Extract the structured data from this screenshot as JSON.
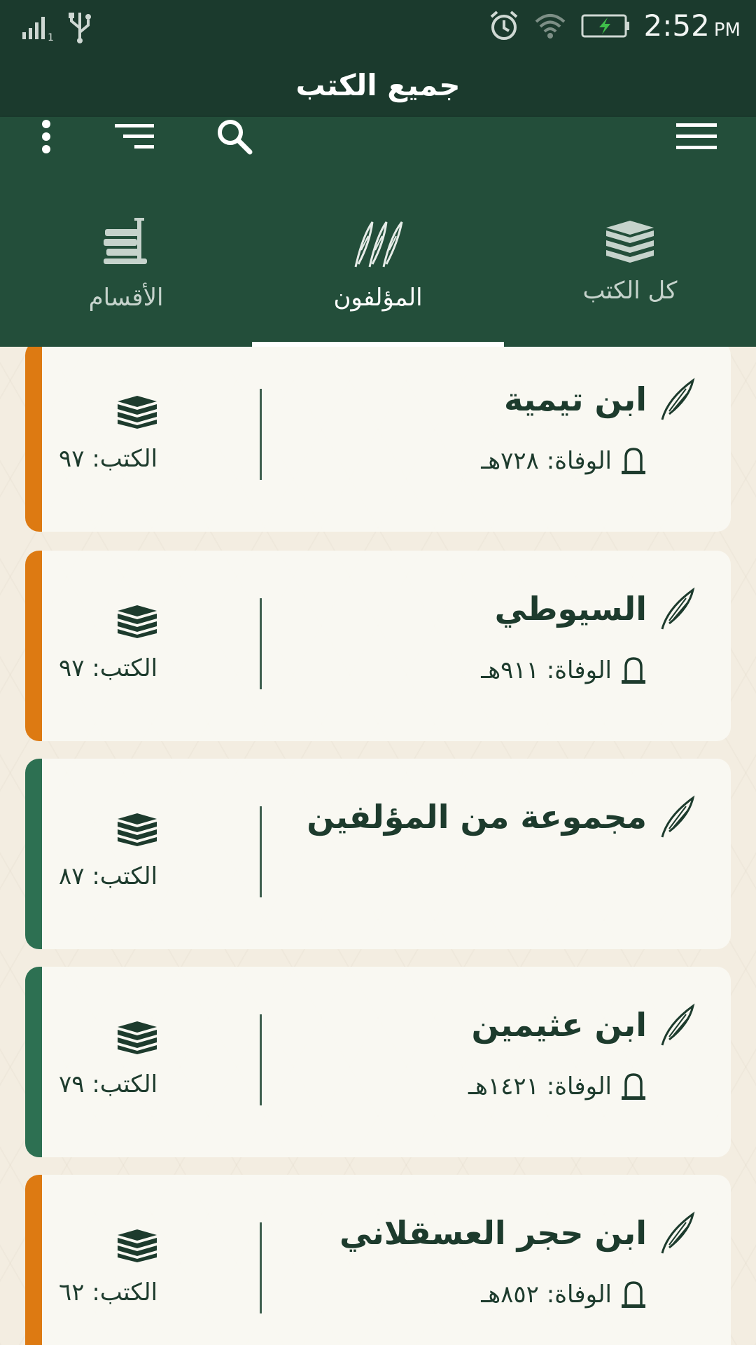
{
  "status_bar": {
    "time": "2:52",
    "ampm": "PM",
    "signal_sub": "1"
  },
  "title_bar": {
    "title": "جميع الكتب"
  },
  "toolbar": {
    "icons": [
      "more-vert-icon",
      "sort-icon",
      "search-icon",
      "menu-icon"
    ]
  },
  "tabs": [
    {
      "label": "الأقسام",
      "icon": "sections-icon",
      "active": false
    },
    {
      "label": "المؤلفون",
      "icon": "quills-icon",
      "active": true
    },
    {
      "label": "كل الكتب",
      "icon": "books-stack-icon",
      "active": false
    }
  ],
  "authors": [
    {
      "name": "ابن تيمية",
      "death": "الوفاة: ٧٢٨هـ",
      "books": "الكتب: ٩٧",
      "stripe_color": "#dd7a12"
    },
    {
      "name": "السيوطي",
      "death": "الوفاة: ٩١١هـ",
      "books": "الكتب: ٩٧",
      "stripe_color": "#dd7a12"
    },
    {
      "name": "مجموعة من المؤلفين",
      "death": "",
      "books": "الكتب: ٨٧",
      "stripe_color": "#2d7052"
    },
    {
      "name": "ابن عثيمين",
      "death": "الوفاة: ١٤٢١هـ",
      "books": "الكتب: ٧٩",
      "stripe_color": "#2d7052"
    },
    {
      "name": "ابن حجر العسقلاني",
      "death": "الوفاة: ٨٥٢هـ",
      "books": "الكتب: ٦٢",
      "stripe_color": "#dd7a12"
    }
  ],
  "colors": {
    "header_dark": "#1b3a2d",
    "header": "#234e3a",
    "text_dark": "#1d3b2d"
  }
}
